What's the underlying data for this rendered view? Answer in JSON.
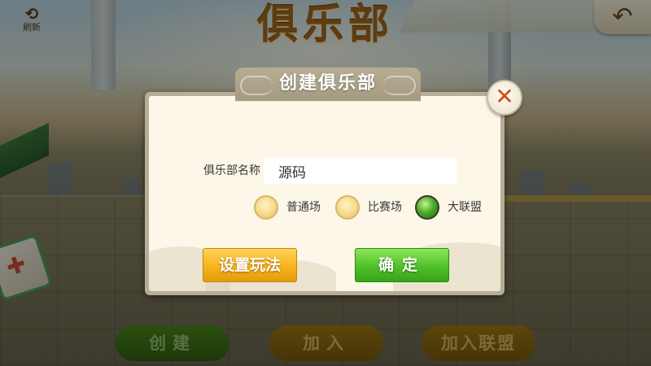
{
  "background": {
    "club_title": "俱乐部",
    "refresh_label": "刷新",
    "refresh_icon": "refresh-icon",
    "back_icon": "back-arrow-icon"
  },
  "bottom_bar": {
    "create_label": "创建",
    "join_label": "加入",
    "join_alliance_label": "加入联盟"
  },
  "dialog": {
    "title": "创建俱乐部",
    "close_icon": "close-icon",
    "name_label": "俱乐部名称",
    "name_value": "源码",
    "modes": [
      {
        "label": "普通场",
        "selected": false
      },
      {
        "label": "比赛场",
        "selected": false
      },
      {
        "label": "大联盟",
        "selected": true
      }
    ],
    "set_rules_label": "设置玩法",
    "confirm_label": "确定"
  },
  "colors": {
    "confirm_green": "#4fc02a",
    "rules_orange": "#f7b41c",
    "dialog_bg": "#fcf7e8",
    "title_brown": "#a0691b"
  }
}
